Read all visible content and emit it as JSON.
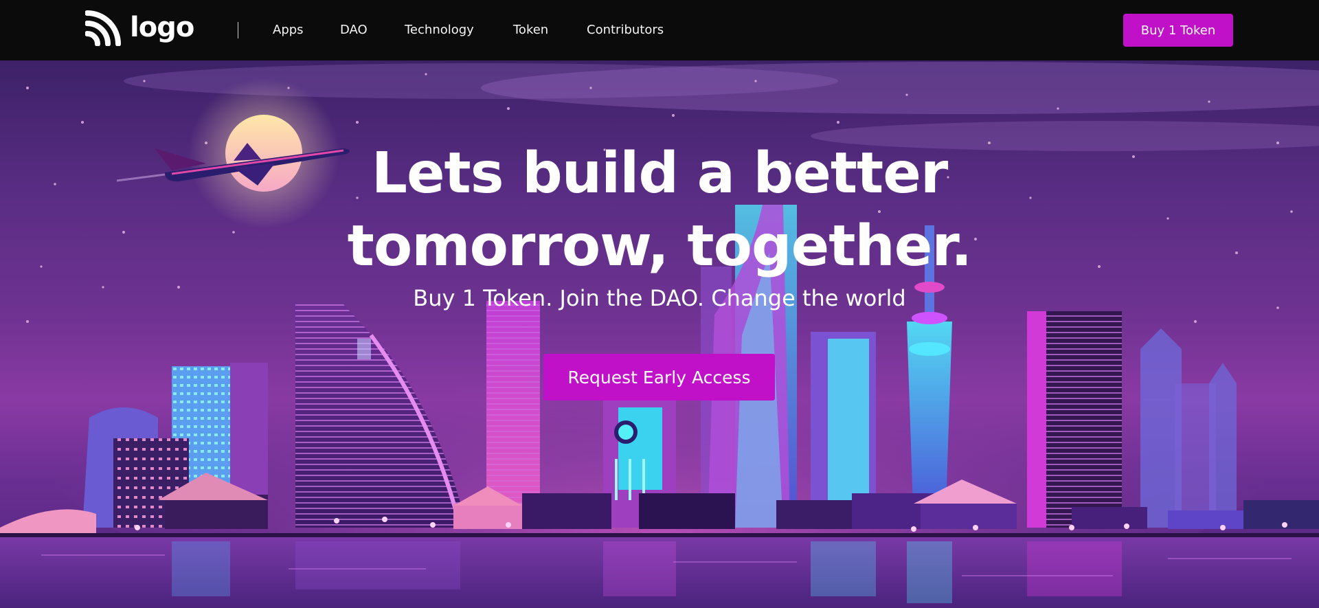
{
  "brand": {
    "logo_text": "logo",
    "logo_icon": "signal-waves-icon"
  },
  "nav": {
    "links": [
      "Apps",
      "DAO",
      "Technology",
      "Token",
      "Contributors"
    ],
    "cta_label": "Buy 1 Token"
  },
  "hero": {
    "title_line1": "Lets build a better",
    "title_line2": "tomorrow, together.",
    "subtitle": "Buy 1 Token. Join the DAO. Change the world",
    "cta_label": "Request Early Access"
  },
  "colors": {
    "accent": "#c111c8",
    "nav_bg": "#0b0b0c",
    "text": "#ffffff",
    "sky_top": "#3d2168",
    "sky_mid": "#8a3aa4"
  }
}
